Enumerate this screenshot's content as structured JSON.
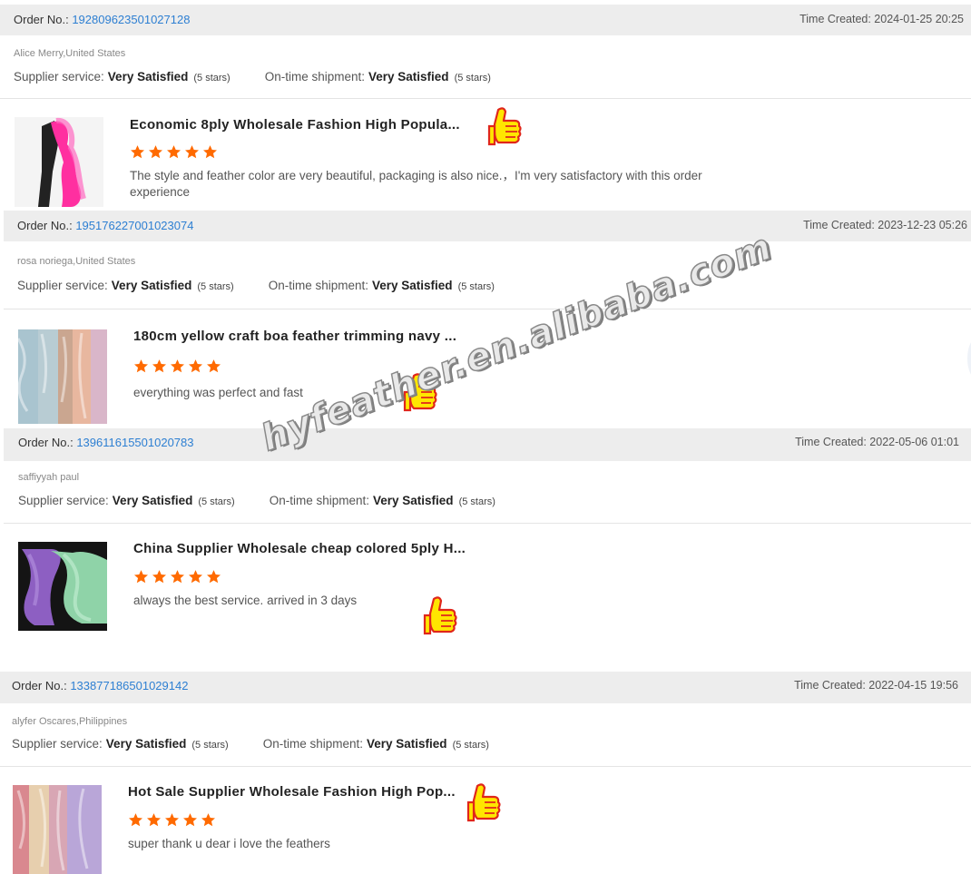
{
  "labels": {
    "order_no": "Order No.:",
    "time_created": "Time Created:",
    "supplier_service": "Supplier service:",
    "ontime_shipment": "On-time shipment:"
  },
  "watermark": "hyfeather.en.alibaba.com",
  "icons": {
    "rating_star": "star-icon",
    "thumbs_up": "thumbs-up-icon"
  },
  "colors": {
    "order_number": "#2d7fd2",
    "star": "#ff6a00",
    "header_bg": "#ededed",
    "thumb_yellow": "#ffe600",
    "thumb_red": "#e0261b"
  },
  "reviews": [
    {
      "order_no": "192809623501027128",
      "time_created": "Time Created: 2024-01-25 20:25",
      "buyer": "Alice Merry,United States",
      "supplier_service": {
        "rating": "Very Satisfied",
        "stars_text": "(5 stars)"
      },
      "ontime_shipment": {
        "rating": "Very Satisfied",
        "stars_text": "(5 stars)"
      },
      "product_title": "Economic 8ply Wholesale Fashion High Popula...",
      "star_rating": 5,
      "text": "The style and feather color are very beautiful, packaging is also nice.，I'm very satisfactory with this order experience"
    },
    {
      "order_no": "195176227001023074",
      "time_created": "Time Created: 2023-12-23 05:26",
      "buyer": "rosa noriega,United States",
      "supplier_service": {
        "rating": "Very Satisfied",
        "stars_text": "(5 stars)"
      },
      "ontime_shipment": {
        "rating": "Very Satisfied",
        "stars_text": "(5 stars)"
      },
      "product_title": "180cm yellow craft boa feather trimming navy ...",
      "star_rating": 5,
      "text": "everything was perfect and fast"
    },
    {
      "order_no": "139611615501020783",
      "time_created": "Time Created: 2022-05-06 01:01",
      "buyer": "saffiyyah paul",
      "supplier_service": {
        "rating": "Very Satisfied",
        "stars_text": "(5 stars)"
      },
      "ontime_shipment": {
        "rating": "Very Satisfied",
        "stars_text": "(5 stars)"
      },
      "product_title": "China Supplier Wholesale cheap colored 5ply H...",
      "star_rating": 5,
      "text": "always the best service. arrived in 3 days"
    },
    {
      "order_no": "133877186501029142",
      "time_created": "Time Created: 2022-04-15 19:56",
      "buyer": "alyfer Oscares,Philippines",
      "supplier_service": {
        "rating": "Very Satisfied",
        "stars_text": "(5 stars)"
      },
      "ontime_shipment": {
        "rating": "Very Satisfied",
        "stars_text": "(5 stars)"
      },
      "product_title": "Hot Sale Supplier Wholesale Fashion High Pop...",
      "star_rating": 5,
      "text": "super thank u dear i love the feathers"
    }
  ]
}
